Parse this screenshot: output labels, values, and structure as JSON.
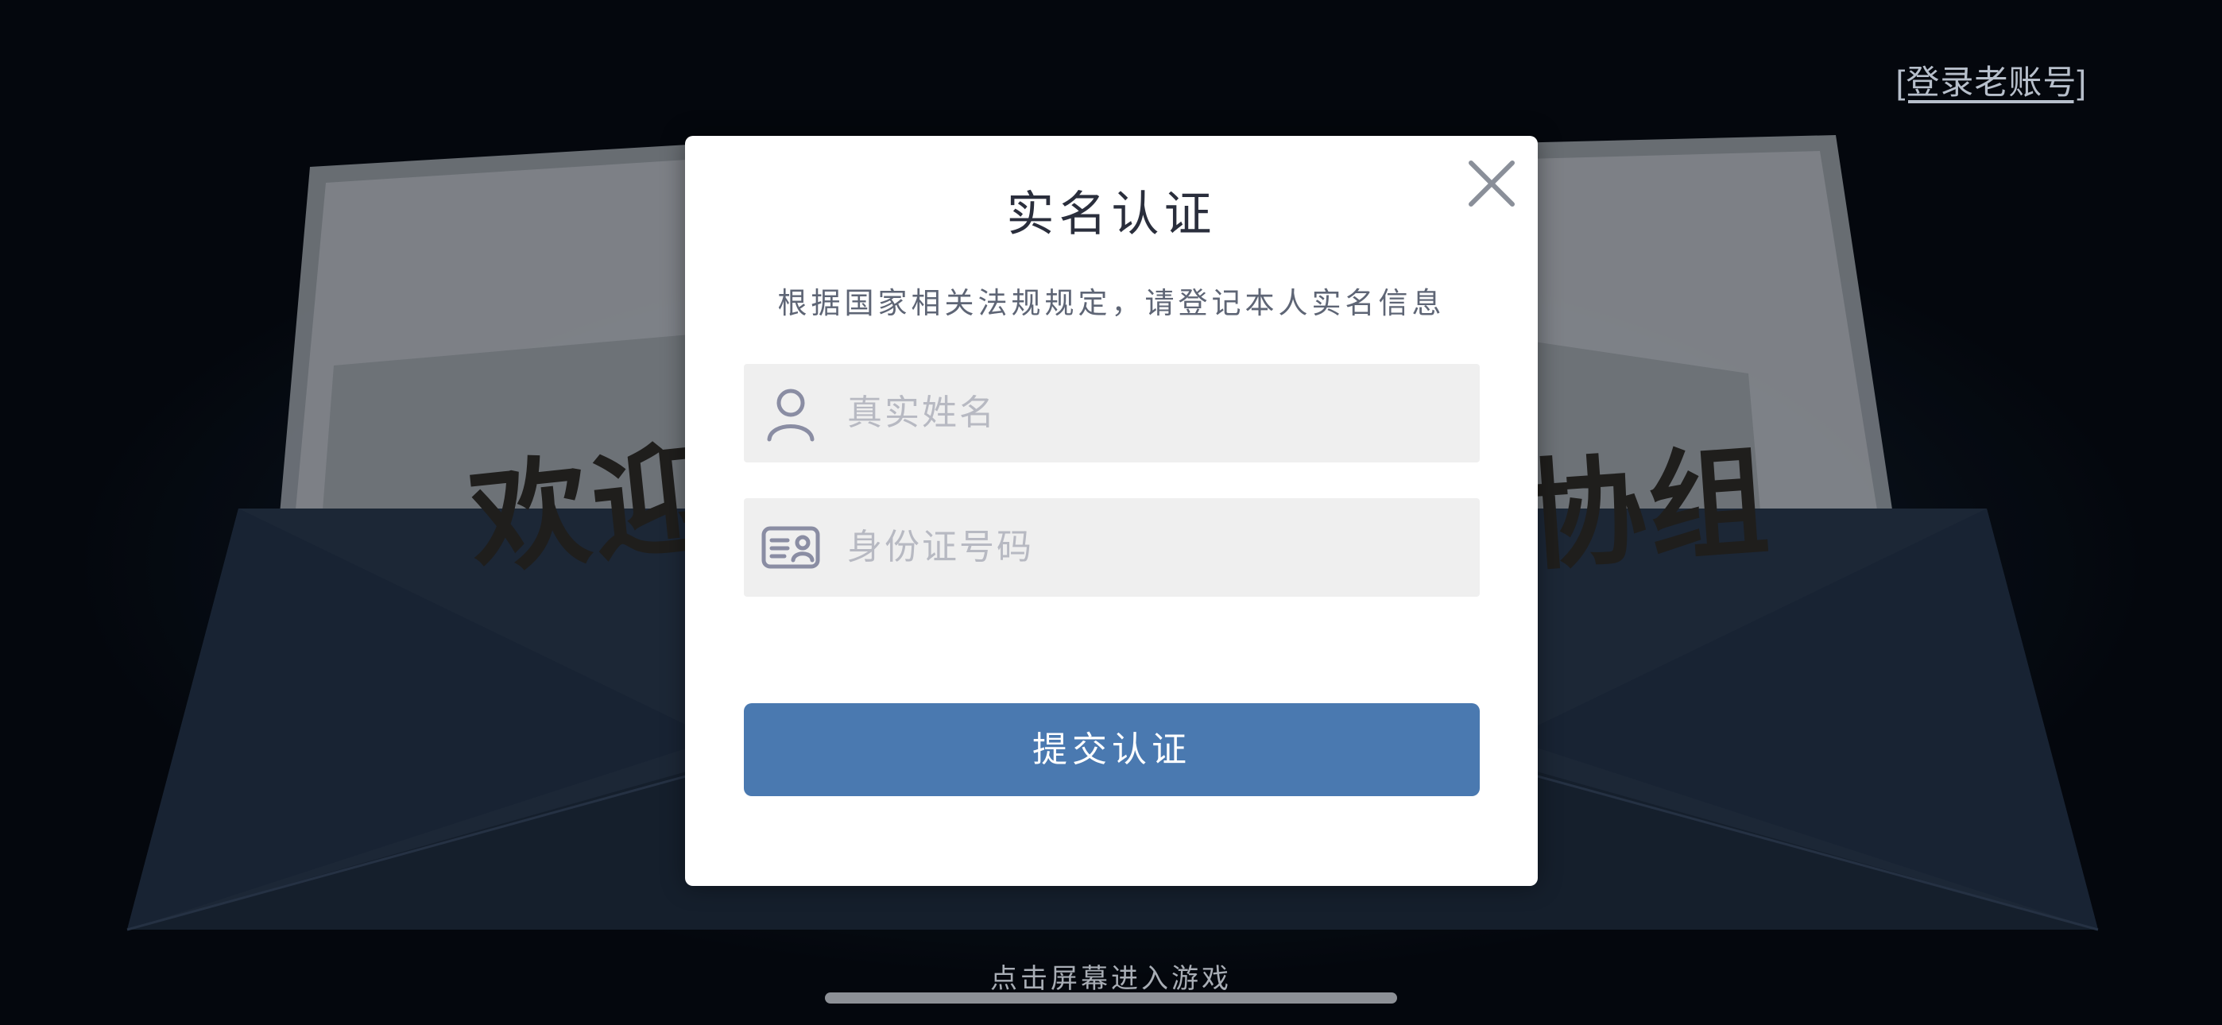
{
  "header": {
    "old_account_link": "[登录老账号]"
  },
  "background": {
    "poster_left_text": "欢迎",
    "poster_right_text": "协组",
    "enter_hint": "点击屏幕进入游戏"
  },
  "dialog": {
    "title": "实名认证",
    "subtitle": "根据国家相关法规规定，请登记本人实名信息",
    "name_field": {
      "placeholder": "真实姓名",
      "icon": "user-icon"
    },
    "id_field": {
      "placeholder": "身份证号码",
      "icon": "id-card-icon"
    },
    "submit_label": "提交认证",
    "close_icon": "close-icon"
  },
  "colors": {
    "accent": "#4a79b0",
    "field_bg": "#efefef",
    "placeholder": "#b7b9c2"
  }
}
